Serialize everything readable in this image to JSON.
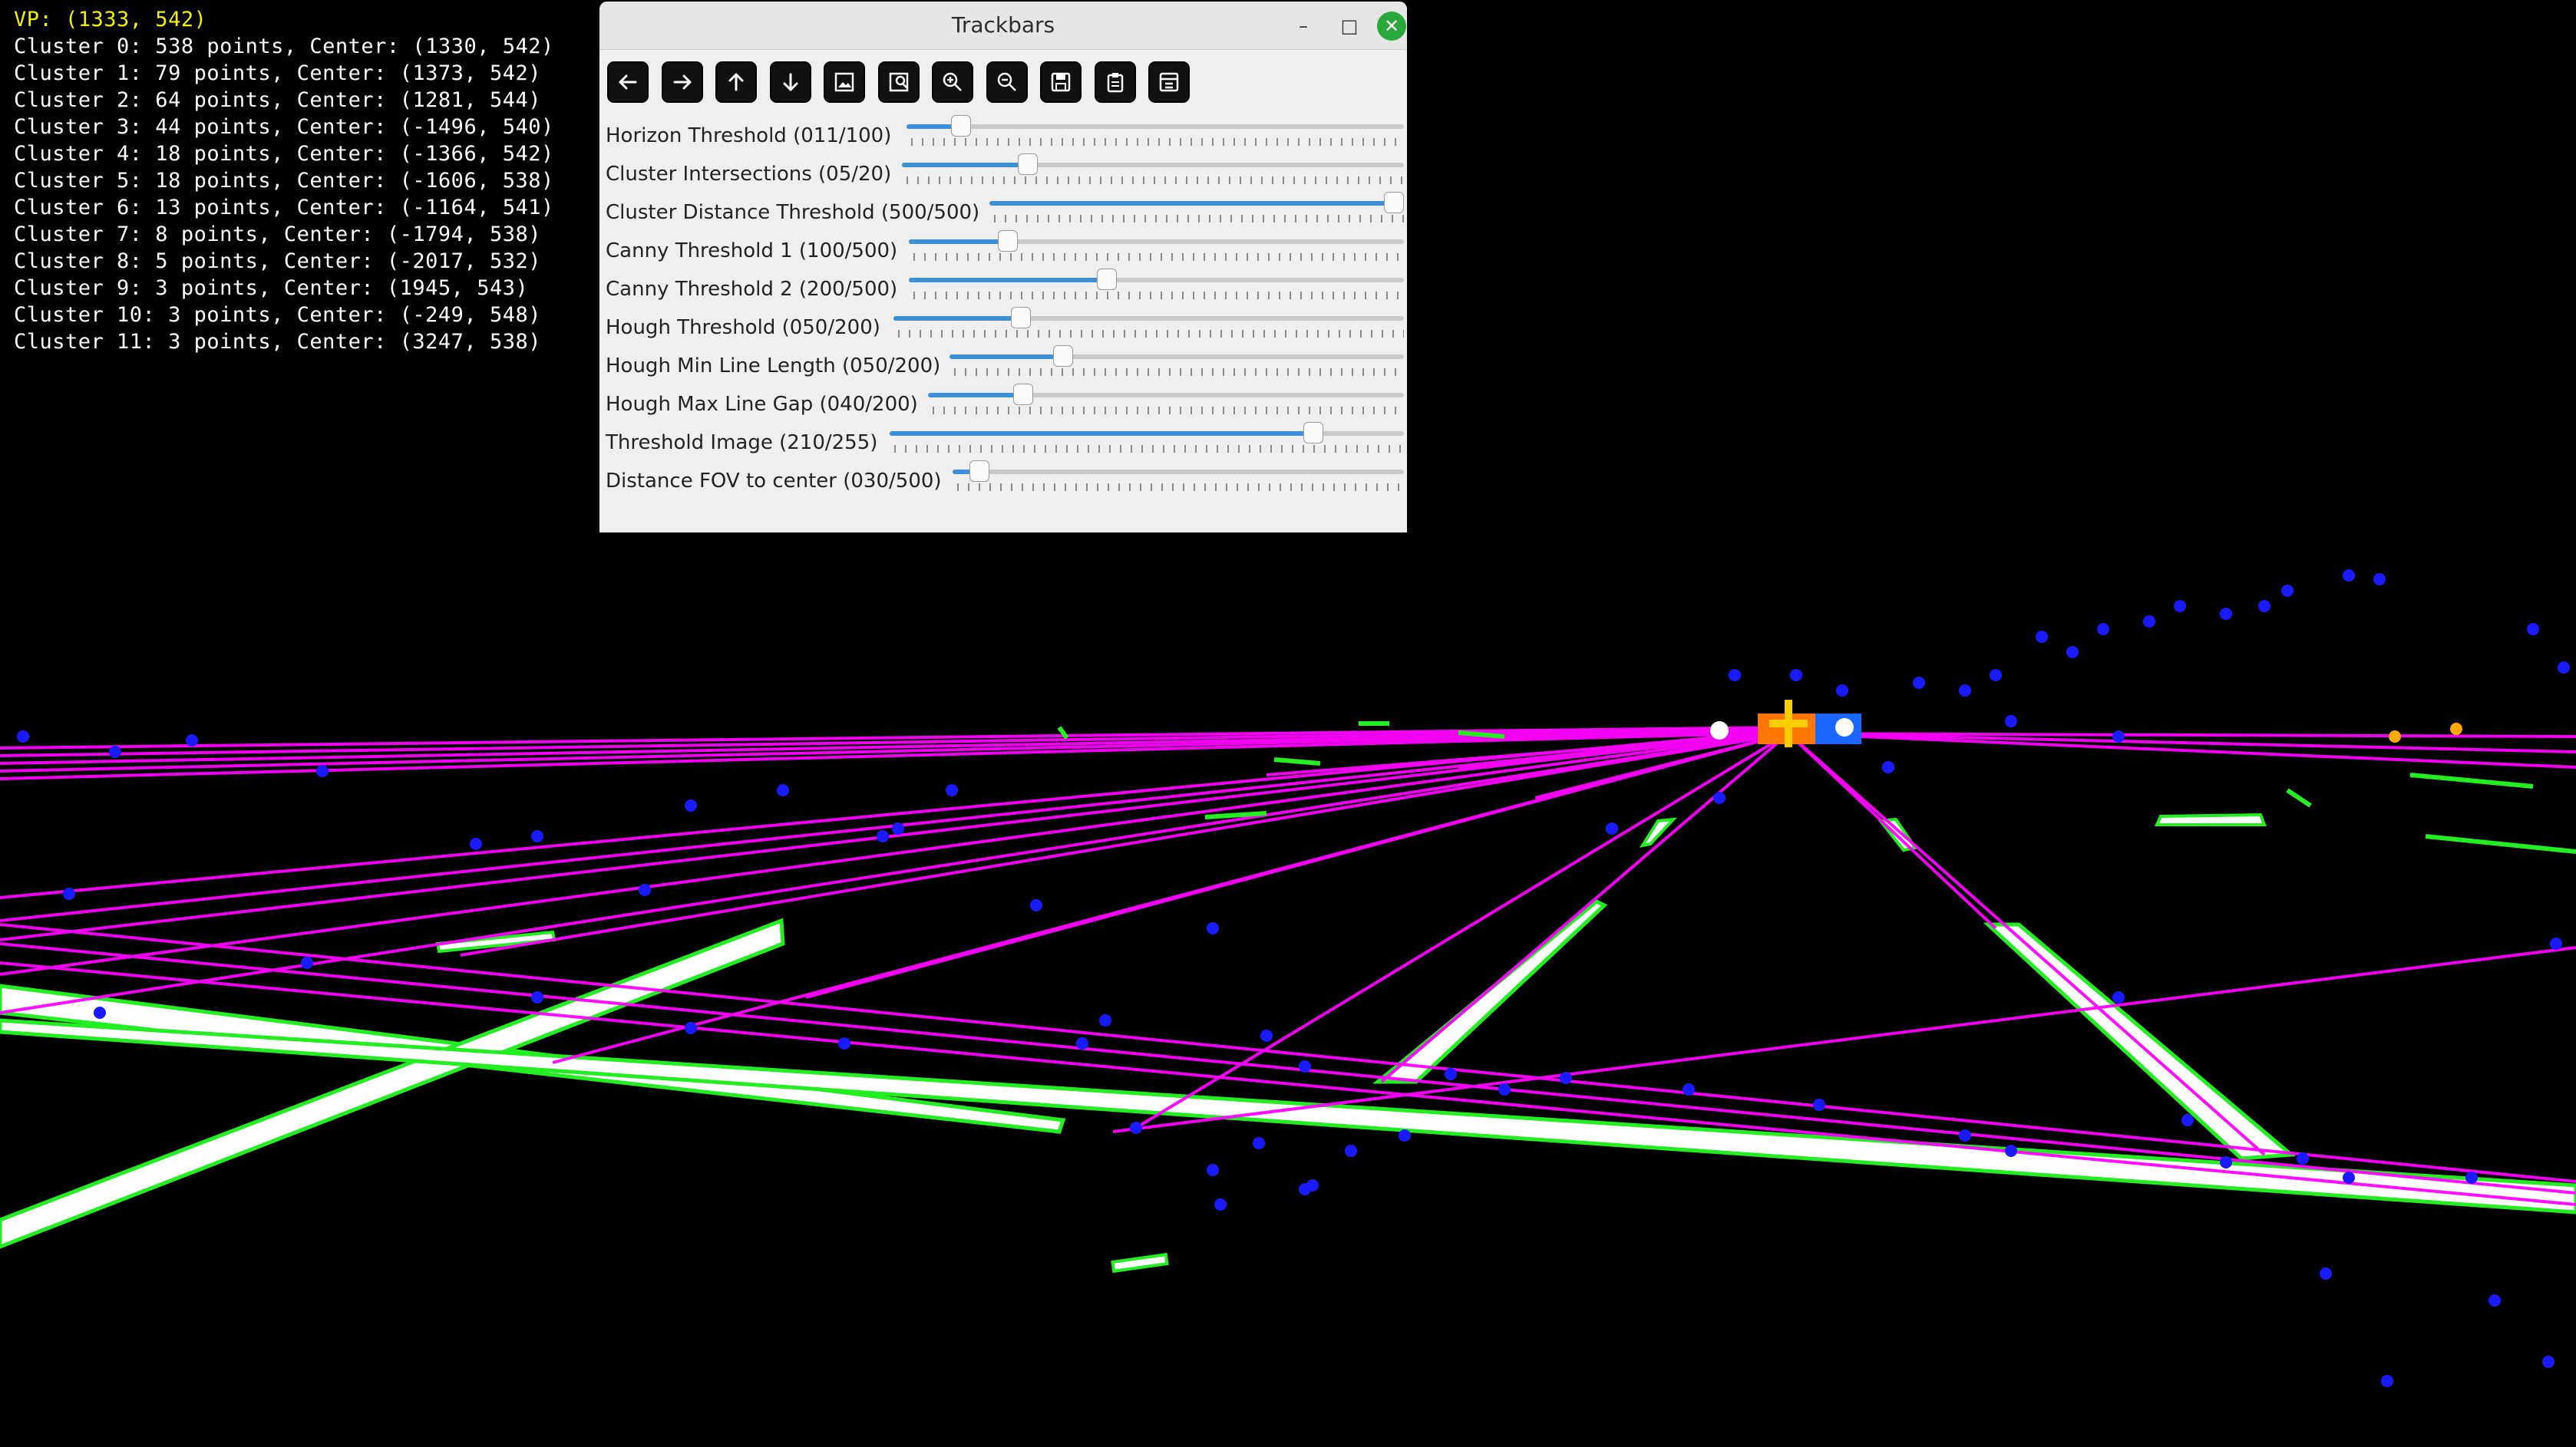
{
  "overlay": {
    "vp_line": "VP: (1333, 542)",
    "cluster_lines": [
      "Cluster 0: 538 points, Center: (1330, 542)",
      "Cluster 1: 79 points, Center: (1373, 542)",
      "Cluster 2: 64 points, Center: (1281, 544)",
      "Cluster 3: 44 points, Center: (-1496, 540)",
      "Cluster 4: 18 points, Center: (-1366, 542)",
      "Cluster 5: 18 points, Center: (-1606, 538)",
      "Cluster 6: 13 points, Center: (-1164, 541)",
      "Cluster 7: 8 points, Center: (-1794, 538)",
      "Cluster 8: 5 points, Center: (-2017, 532)",
      "Cluster 9: 3 points, Center: (1945, 543)",
      "Cluster 10: 3 points, Center: (-249, 548)",
      "Cluster 11: 3 points, Center: (3247, 538)"
    ],
    "colors": {
      "vp": "#f5f000",
      "text": "#ffffff"
    }
  },
  "window": {
    "title": "Trackbars",
    "controls": {
      "minimize": "–",
      "maximize": "□",
      "close": "✕"
    },
    "toolbar_icons": [
      "arrow-left-icon",
      "arrow-right-icon",
      "arrow-up-icon",
      "arrow-down-icon",
      "image-icon",
      "image-search-icon",
      "zoom-in-icon",
      "zoom-out-icon",
      "save-icon",
      "clipboard-icon",
      "properties-icon"
    ],
    "trackbars": [
      {
        "label": "Horizon Threshold (011/100)",
        "value": 11,
        "max": 100
      },
      {
        "label": "Cluster Intersections (05/20)",
        "value": 5,
        "max": 20
      },
      {
        "label": "Cluster Distance Threshold (500/500)",
        "value": 500,
        "max": 500
      },
      {
        "label": "Canny Threshold 1 (100/500)",
        "value": 100,
        "max": 500
      },
      {
        "label": "Canny Threshold 2 (200/500)",
        "value": 200,
        "max": 500
      },
      {
        "label": "Hough Threshold (050/200)",
        "value": 50,
        "max": 200
      },
      {
        "label": "Hough Min Line Length (050/200)",
        "value": 50,
        "max": 200
      },
      {
        "label": "Hough Max Line Gap (040/200)",
        "value": 40,
        "max": 200
      },
      {
        "label": "Threshold Image (210/255)",
        "value": 210,
        "max": 255
      },
      {
        "label": "Distance FOV to center (030/500)",
        "value": 30,
        "max": 500
      }
    ]
  },
  "scene": {
    "colors": {
      "background": "#000000",
      "lane": "#ffffff",
      "edge": "#22ee22",
      "hough_lines": "#ff00ff",
      "intersections": "#1a1aff",
      "vanishing_point": "#ffcc00"
    }
  }
}
